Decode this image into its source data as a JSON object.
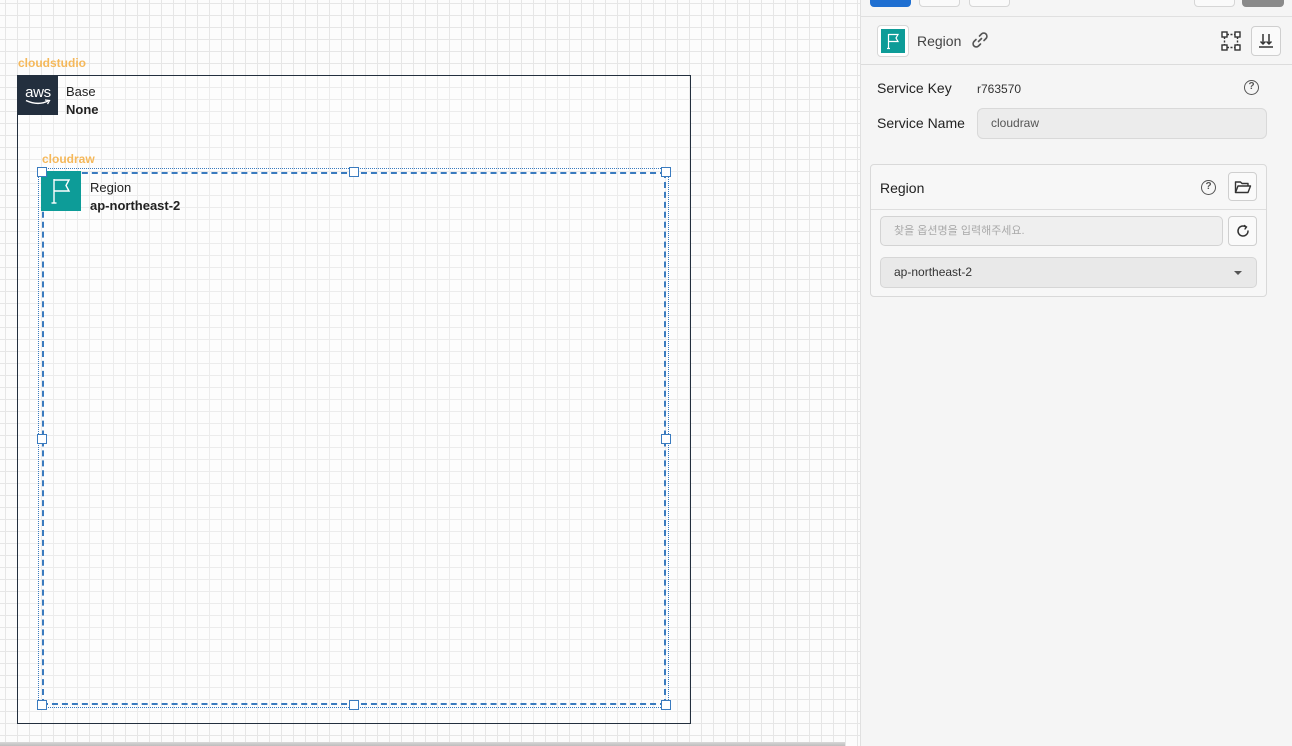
{
  "canvas": {
    "base_group": {
      "label": "cloudstudio",
      "title": "Base",
      "value": "None",
      "logo_text": "aws",
      "logo_icon": "aws-logo-icon"
    },
    "region_group": {
      "label": "cloudraw",
      "title": "Region",
      "value": "ap-northeast-2",
      "icon": "flag-icon"
    }
  },
  "panel": {
    "header": {
      "title": "Region",
      "icon": "flag-icon",
      "link_icon": "link-icon",
      "layout_icon": "node-layout-icon",
      "sort_icon": "sort-down-icon"
    },
    "service_key": {
      "label": "Service Key",
      "value": "r763570"
    },
    "service_name": {
      "label": "Service Name",
      "value": "cloudraw"
    },
    "region_card": {
      "title": "Region",
      "search_placeholder": "찾을 옵션명을 입력해주세요.",
      "selected": "ap-northeast-2"
    }
  },
  "colors": {
    "accent_teal": "#0d9c98",
    "aws_dark": "#232f3e",
    "selection_blue": "#3a7bbf",
    "group_label_orange": "#f5b85a",
    "top_button_blue": "#1f6fd1"
  }
}
